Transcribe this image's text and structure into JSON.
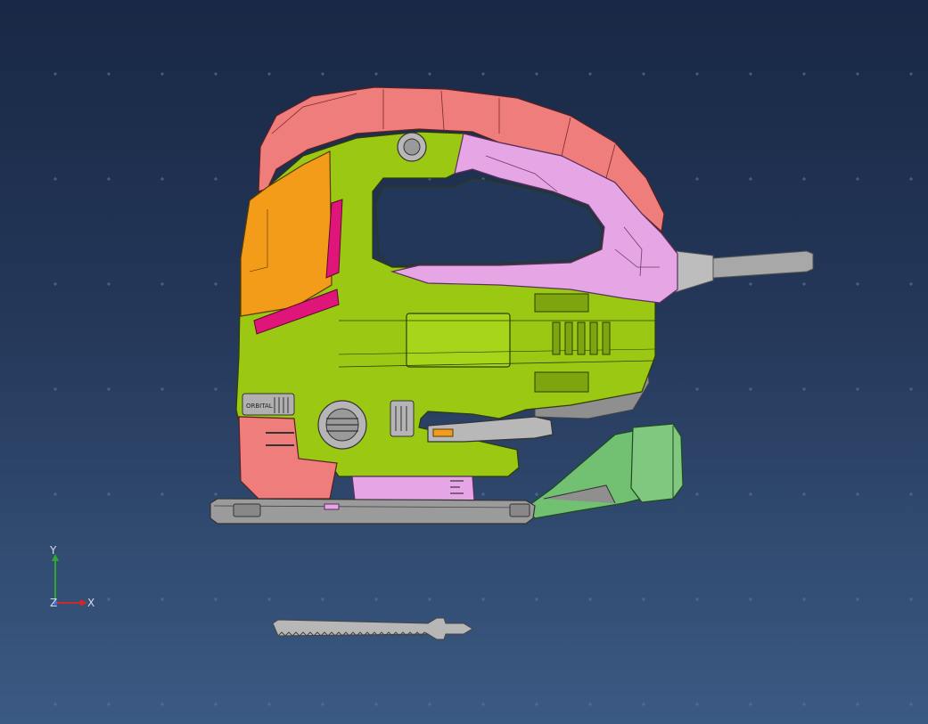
{
  "viewport": {
    "background_top": "#182845",
    "background_bottom": "#3b5a83"
  },
  "axes": {
    "x_label": "X",
    "y_label": "Y",
    "z_label": "Z",
    "x_color": "#d02828",
    "y_color": "#2ea82e",
    "z_color": "#3a6fe0"
  },
  "model": {
    "housing_primary_color": "#9bc812",
    "handle_top_color": "#ee7d7c",
    "handle_inner_color": "#e6a6e6",
    "side_panel_color": "#f39c1a",
    "accent_stripe_color": "#e0157a",
    "dust_port_color": "#72c072",
    "base_plate_color": "#9b9b9b",
    "power_cord_color": "#a8a8a8",
    "selector_label": "ORBITAL"
  },
  "part": {
    "blade_color": "#b7b7b7"
  }
}
